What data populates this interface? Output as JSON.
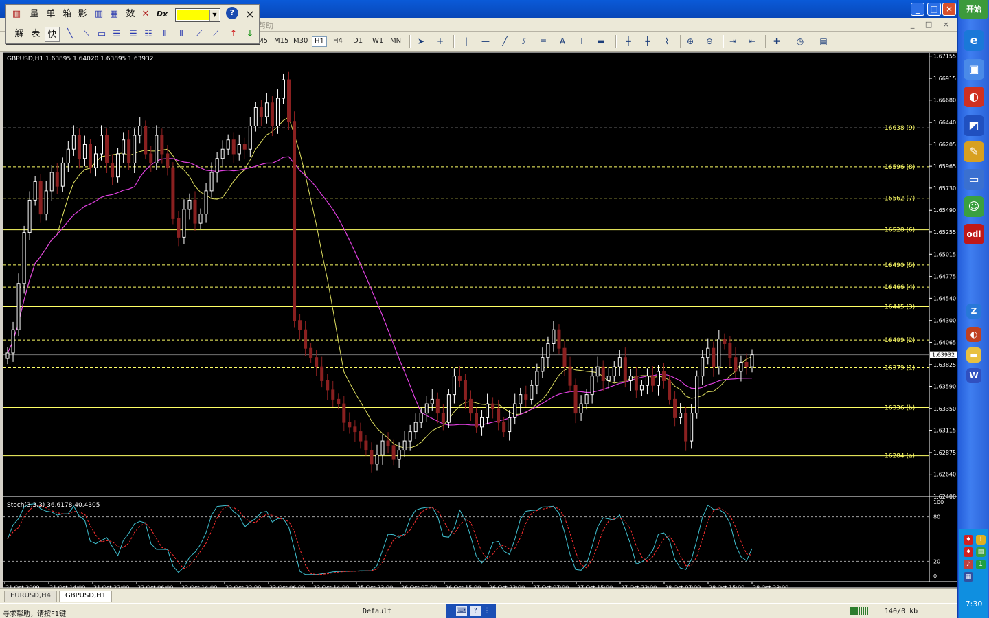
{
  "window": {
    "min_label": "_",
    "max_label": "□",
    "close_label": "×"
  },
  "menu": {
    "help_label": "帮助"
  },
  "float_toolbar": {
    "row1": [
      "量",
      "单",
      "箱",
      "影",
      "数"
    ],
    "row2": [
      "解",
      "表",
      "快"
    ],
    "help_icon_label": "?",
    "close_label": "×",
    "dx_label": "Dx",
    "color": "#ffff00"
  },
  "toolbar": {
    "timeframes": [
      "M5",
      "M15",
      "M30",
      "H1",
      "H4",
      "D1",
      "W1",
      "MN"
    ],
    "active_timeframe": "H1",
    "text_tool_label": "A",
    "label_tool_label": "T"
  },
  "chart": {
    "symbol_header": "GBPUSD,H1  1.63895 1.64020 1.63895 1.63932",
    "current_price_tag": "1.63932",
    "price_ticks": [
      "1.67155",
      "1.66915",
      "1.66680",
      "1.66440",
      "1.66205",
      "1.65965",
      "1.65730",
      "1.65490",
      "1.65255",
      "1.65015",
      "1.64775",
      "1.64540",
      "1.64300",
      "1.64065",
      "1.63825",
      "1.63590",
      "1.63350",
      "1.63115",
      "1.62875",
      "1.62640",
      "1.62400"
    ],
    "levels": [
      {
        "label": "16638 (9)",
        "price": 1.6638,
        "style": "dash",
        "color": "#c8c8c8"
      },
      {
        "label": "16596 (8)",
        "price": 1.6596,
        "style": "dash",
        "color": "#ffff66"
      },
      {
        "label": "16562 (7)",
        "price": 1.6562,
        "style": "dash",
        "color": "#ffff66"
      },
      {
        "label": "16528 (6)",
        "price": 1.6528,
        "style": "solid",
        "color": "#ffff66"
      },
      {
        "label": "16490 (5)",
        "price": 1.649,
        "style": "dash",
        "color": "#ffff66"
      },
      {
        "label": "16466 (4)",
        "price": 1.6466,
        "style": "dash",
        "color": "#ffff66"
      },
      {
        "label": "16445 (3)",
        "price": 1.6445,
        "style": "solid",
        "color": "#ffff66"
      },
      {
        "label": "16409 (2)",
        "price": 1.6409,
        "style": "dash",
        "color": "#ffff66"
      },
      {
        "label": "16379 (1)",
        "price": 1.6379,
        "style": "dash",
        "color": "#ffff66"
      },
      {
        "label": "16336 (b)",
        "price": 1.6336,
        "style": "solid",
        "color": "#ffff66"
      },
      {
        "label": "16284 (a)",
        "price": 1.6284,
        "style": "solid",
        "color": "#ffff66"
      }
    ],
    "time_labels": [
      "21 Oct 2009",
      "21 Oct 14:00",
      "21 Oct 22:00",
      "22 Oct 06:00",
      "22 Oct 14:00",
      "22 Oct 22:00",
      "23 Oct 06:00",
      "23 Oct 14:00",
      "25 Oct 23:00",
      "26 Oct 07:00",
      "26 Oct 15:00",
      "26 Oct 23:00",
      "27 Oct 07:00",
      "27 Oct 15:00",
      "27 Oct 23:00",
      "28 Oct 07:00",
      "28 Oct 15:00",
      "28 Oct 23:00"
    ],
    "stoch_header": "Stoch(3,3,3) 36.6178 40.4305",
    "stoch_levels": [
      "100",
      "80",
      "20",
      "0"
    ]
  },
  "chart_data": {
    "type": "candlestick",
    "symbol": "GBPUSD",
    "timeframe": "H1",
    "ylim": [
      1.624,
      1.6716
    ],
    "closes": [
      1.6395,
      1.642,
      1.647,
      1.6525,
      1.656,
      1.658,
      1.6545,
      1.657,
      1.659,
      1.6575,
      1.66,
      1.6615,
      1.663,
      1.6605,
      1.662,
      1.6595,
      1.661,
      1.663,
      1.66,
      1.6585,
      1.661,
      1.6625,
      1.66,
      1.663,
      1.664,
      1.661,
      1.66,
      1.663,
      1.661,
      1.6595,
      1.654,
      1.652,
      1.655,
      1.656,
      1.6535,
      1.6545,
      1.657,
      1.659,
      1.6605,
      1.6615,
      1.6625,
      1.661,
      1.662,
      1.6615,
      1.664,
      1.666,
      1.665,
      1.6665,
      1.664,
      1.667,
      1.669,
      1.6645,
      1.643,
      1.642,
      1.64,
      1.639,
      1.638,
      1.6365,
      1.6355,
      1.6345,
      1.634,
      1.632,
      1.6315,
      1.631,
      1.63,
      1.629,
      1.6275,
      1.6285,
      1.63,
      1.6295,
      1.628,
      1.629,
      1.63,
      1.631,
      1.632,
      1.633,
      1.634,
      1.6345,
      1.633,
      1.632,
      1.635,
      1.637,
      1.6365,
      1.6345,
      1.633,
      1.6315,
      1.6325,
      1.634,
      1.6335,
      1.632,
      1.631,
      1.6325,
      1.634,
      1.635,
      1.6345,
      1.636,
      1.6375,
      1.639,
      1.6405,
      1.642,
      1.64,
      1.638,
      1.636,
      1.633,
      1.634,
      1.635,
      1.637,
      1.638,
      1.6365,
      1.637,
      1.638,
      1.639,
      1.6365,
      1.637,
      1.6355,
      1.636,
      1.637,
      1.636,
      1.6375,
      1.6365,
      1.6345,
      1.6325,
      1.633,
      1.63,
      1.633,
      1.637,
      1.639,
      1.64,
      1.638,
      1.641,
      1.6405,
      1.639,
      1.6375,
      1.6385,
      1.638,
      1.6393
    ],
    "ma_fast_color": "#e0e060",
    "ma_slow_color": "#e040e0",
    "stoch_k_color": "#40c0d0",
    "stoch_d_color": "#ff3030",
    "bull_color": "#ffffff",
    "bear_color": "#8a2020"
  },
  "tabs": [
    "EURUSD,H4",
    "GBPUSD,H1"
  ],
  "active_tab": "GBPUSD,H1",
  "status": {
    "help_text": "寻求帮助，请按F1键",
    "profile": "Default",
    "traffic": "140/0 kb"
  },
  "taskbar": {
    "start_label": "开始",
    "clock": "7:30"
  }
}
